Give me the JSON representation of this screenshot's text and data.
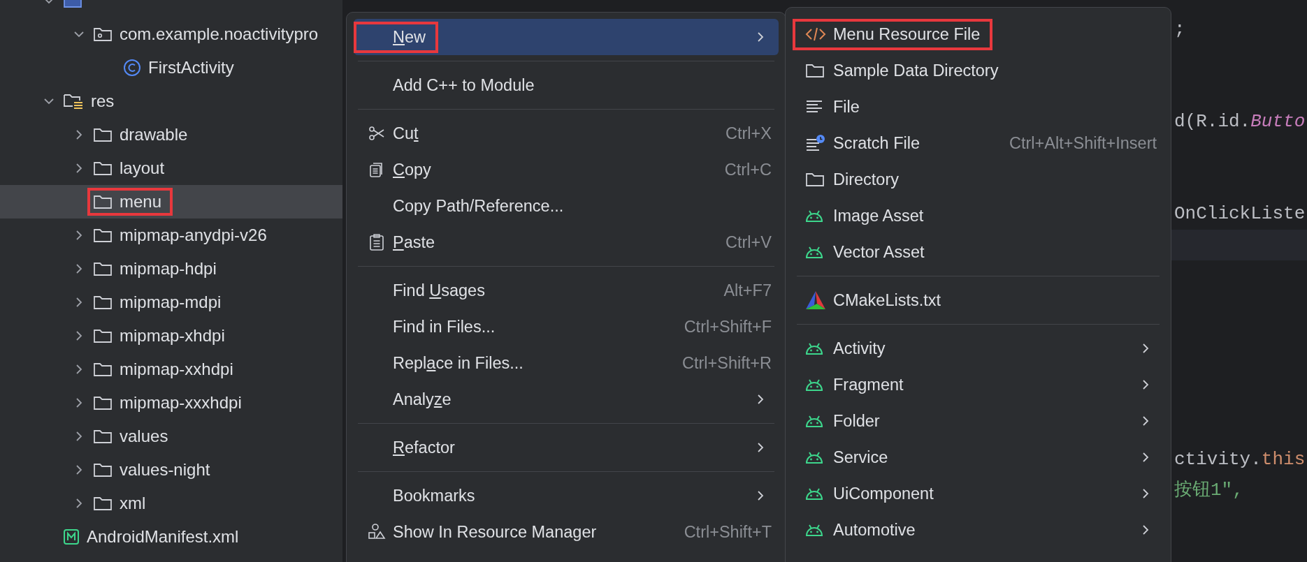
{
  "project_tree": {
    "items": [
      {
        "kind": "source-folder",
        "expanded": true,
        "selected": false,
        "annotated": false,
        "children": [
          {
            "label": "com.example.noactivitypro",
            "kind": "package",
            "expanded": true,
            "selected": false,
            "annotated": false,
            "children": [
              {
                "label": "FirstActivity",
                "kind": "class",
                "selected": false,
                "annotated": false
              }
            ]
          }
        ]
      },
      {
        "label": "res",
        "kind": "res-folder",
        "expanded": true,
        "selected": false,
        "annotated": false,
        "children": [
          {
            "label": "drawable",
            "kind": "folder",
            "expanded": false,
            "selected": false,
            "annotated": false
          },
          {
            "label": "layout",
            "kind": "folder",
            "expanded": false,
            "selected": false,
            "annotated": false
          },
          {
            "label": "menu",
            "kind": "folder",
            "selected": true,
            "annotated": true
          },
          {
            "label": "mipmap-anydpi-v26",
            "kind": "folder",
            "expanded": false,
            "selected": false,
            "annotated": false
          },
          {
            "label": "mipmap-hdpi",
            "kind": "folder",
            "expanded": false,
            "selected": false,
            "annotated": false
          },
          {
            "label": "mipmap-mdpi",
            "kind": "folder",
            "expanded": false,
            "selected": false,
            "annotated": false
          },
          {
            "label": "mipmap-xhdpi",
            "kind": "folder",
            "expanded": false,
            "selected": false,
            "annotated": false
          },
          {
            "label": "mipmap-xxhdpi",
            "kind": "folder",
            "expanded": false,
            "selected": false,
            "annotated": false
          },
          {
            "label": "mipmap-xxxhdpi",
            "kind": "folder",
            "expanded": false,
            "selected": false,
            "annotated": false
          },
          {
            "label": "values",
            "kind": "folder",
            "expanded": false,
            "selected": false,
            "annotated": false
          },
          {
            "label": "values-night",
            "kind": "folder",
            "expanded": false,
            "selected": false,
            "annotated": false
          },
          {
            "label": "xml",
            "kind": "folder",
            "expanded": false,
            "selected": false,
            "annotated": false
          }
        ]
      },
      {
        "label": "AndroidManifest.xml",
        "kind": "manifest",
        "selected": false,
        "annotated": false
      }
    ]
  },
  "editor": {
    "lines": [
      {
        "segments": [
          {
            "kind": "plain",
            "text": ";"
          }
        ]
      },
      {
        "segments": [
          {
            "kind": "plain",
            "text": "d(R.id."
          },
          {
            "kind": "field",
            "text": "Butto"
          }
        ]
      },
      {
        "segments": [
          {
            "kind": "plain",
            "text": "OnClickListe"
          }
        ]
      },
      {
        "segments": [
          {
            "kind": "plain",
            "text": "ctivity."
          },
          {
            "kind": "keyword",
            "text": "this"
          }
        ]
      },
      {
        "segments": [
          {
            "kind": "string",
            "text": "按钮1\","
          }
        ]
      }
    ]
  },
  "context_menu": {
    "items": [
      {
        "kind": "item",
        "label": {
          "key": "N",
          "post": "ew"
        },
        "selected": true,
        "annotated": true,
        "submenu": true
      },
      {
        "kind": "separator"
      },
      {
        "kind": "item",
        "label": {
          "pre": "Add C++ to Module"
        },
        "selected": false,
        "annotated": false,
        "submenu": false
      },
      {
        "kind": "separator"
      },
      {
        "kind": "item",
        "label": {
          "pre": "Cu",
          "key": "t"
        },
        "shortcut": "Ctrl+X",
        "selected": false,
        "annotated": false,
        "submenu": false
      },
      {
        "kind": "item",
        "label": {
          "key": "C",
          "post": "opy"
        },
        "shortcut": "Ctrl+C",
        "selected": false,
        "annotated": false,
        "submenu": false
      },
      {
        "kind": "item",
        "label": {
          "pre": "Copy Path/Reference..."
        },
        "selected": false,
        "annotated": false,
        "submenu": false
      },
      {
        "kind": "item",
        "label": {
          "key": "P",
          "post": "aste"
        },
        "shortcut": "Ctrl+V",
        "selected": false,
        "annotated": false,
        "submenu": false
      },
      {
        "kind": "separator"
      },
      {
        "kind": "item",
        "label": {
          "pre": "Find ",
          "key": "U",
          "post": "sages"
        },
        "shortcut": "Alt+F7",
        "selected": false,
        "annotated": false,
        "submenu": false
      },
      {
        "kind": "item",
        "label": {
          "pre": "Find in Files..."
        },
        "shortcut": "Ctrl+Shift+F",
        "selected": false,
        "annotated": false,
        "submenu": false
      },
      {
        "kind": "item",
        "label": {
          "pre": "Repl",
          "key": "a",
          "post": "ce in Files..."
        },
        "shortcut": "Ctrl+Shift+R",
        "selected": false,
        "annotated": false,
        "submenu": false
      },
      {
        "kind": "item",
        "label": {
          "pre": "Analy",
          "key": "z",
          "post": "e"
        },
        "selected": false,
        "annotated": false,
        "submenu": true
      },
      {
        "kind": "separator"
      },
      {
        "kind": "item",
        "label": {
          "key": "R",
          "post": "efactor"
        },
        "selected": false,
        "annotated": false,
        "submenu": true
      },
      {
        "kind": "separator"
      },
      {
        "kind": "item",
        "label": {
          "pre": "Bookmarks"
        },
        "selected": false,
        "annotated": false,
        "submenu": true
      },
      {
        "kind": "item",
        "label": {
          "pre": "Show In Resource Manager"
        },
        "shortcut": "Ctrl+Shift+T",
        "selected": false,
        "annotated": false,
        "submenu": false
      }
    ]
  },
  "new_submenu": {
    "items": [
      {
        "kind": "item",
        "label": "Menu Resource File",
        "selected": false,
        "annotated": true,
        "submenu": false
      },
      {
        "kind": "item",
        "label": "Sample Data Directory",
        "selected": false,
        "annotated": false,
        "submenu": false
      },
      {
        "kind": "item",
        "label": "File",
        "selected": false,
        "annotated": false,
        "submenu": false
      },
      {
        "kind": "item",
        "label": "Scratch File",
        "shortcut": "Ctrl+Alt+Shift+Insert",
        "selected": false,
        "annotated": false,
        "submenu": false
      },
      {
        "kind": "item",
        "label": "Directory",
        "selected": false,
        "annotated": false,
        "submenu": false
      },
      {
        "kind": "item",
        "label": "Image Asset",
        "selected": false,
        "annotated": false,
        "submenu": false
      },
      {
        "kind": "item",
        "label": "Vector Asset",
        "selected": false,
        "annotated": false,
        "submenu": false
      },
      {
        "kind": "separator"
      },
      {
        "kind": "item",
        "label": "CMakeLists.txt",
        "selected": false,
        "annotated": false,
        "submenu": false
      },
      {
        "kind": "separator"
      },
      {
        "kind": "item",
        "label": "Activity",
        "selected": false,
        "annotated": false,
        "submenu": true
      },
      {
        "kind": "item",
        "label": "Fragment",
        "selected": false,
        "annotated": false,
        "submenu": true
      },
      {
        "kind": "item",
        "label": "Folder",
        "selected": false,
        "annotated": false,
        "submenu": true
      },
      {
        "kind": "item",
        "label": "Service",
        "selected": false,
        "annotated": false,
        "submenu": true
      },
      {
        "kind": "item",
        "label": "UiComponent",
        "selected": false,
        "annotated": false,
        "submenu": true
      },
      {
        "kind": "item",
        "label": "Automotive",
        "selected": false,
        "annotated": false,
        "submenu": true
      }
    ]
  }
}
